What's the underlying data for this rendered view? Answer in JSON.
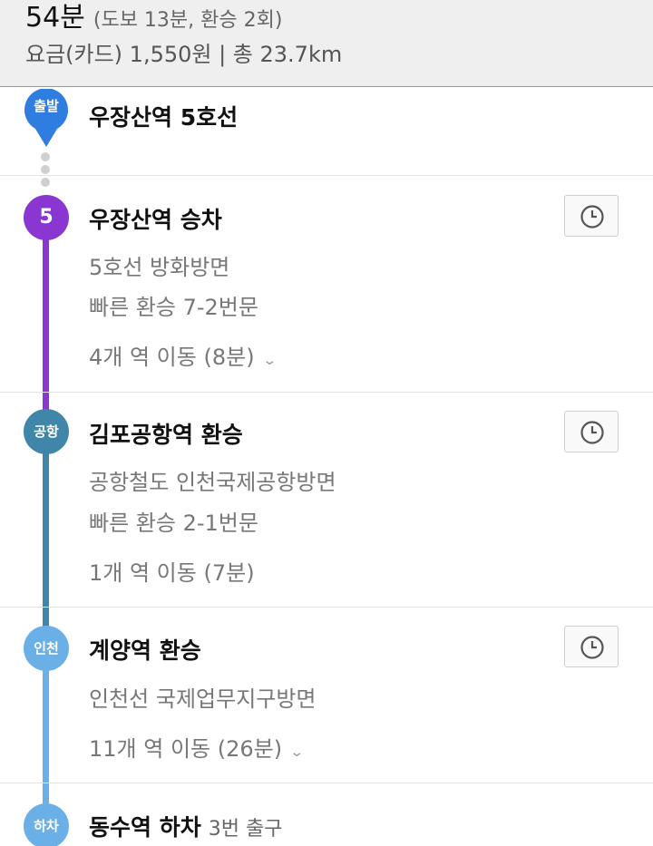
{
  "summary": {
    "total_time": "54분",
    "detail": "(도보 13분, 환승 2회)",
    "fare_distance": "요금(카드) 1,550원 | 총 23.7km"
  },
  "departure": {
    "badge": "출발",
    "title": "우장산역 5호선"
  },
  "steps": [
    {
      "badge": "5",
      "title": "우장산역 승차",
      "direction": "5호선 방화방면",
      "fast_transfer": "빠른 환승 7-2번문",
      "stations": "4개 역 이동 (8분)",
      "expand_icon": "chevron-down-icon"
    },
    {
      "badge": "공항",
      "title": "김포공항역 환승",
      "direction": "공항철도 인천국제공항방면",
      "fast_transfer": "빠른 환승 2-1번문",
      "stations": "1개 역 이동 (7분)"
    },
    {
      "badge": "인천",
      "title": "계양역 환승",
      "direction": "인천선 국제업무지구방면",
      "stations": "11개 역 이동 (26분)",
      "expand_icon": "chevron-down-icon"
    }
  ],
  "arrival": {
    "badge": "하차",
    "title": "동수역 하차",
    "exit": "3번 출구"
  },
  "colors": {
    "line5": "#8a36d0",
    "airport": "#3f86a8",
    "incheon": "#6ab0e6",
    "pin": "#2f7de0"
  }
}
